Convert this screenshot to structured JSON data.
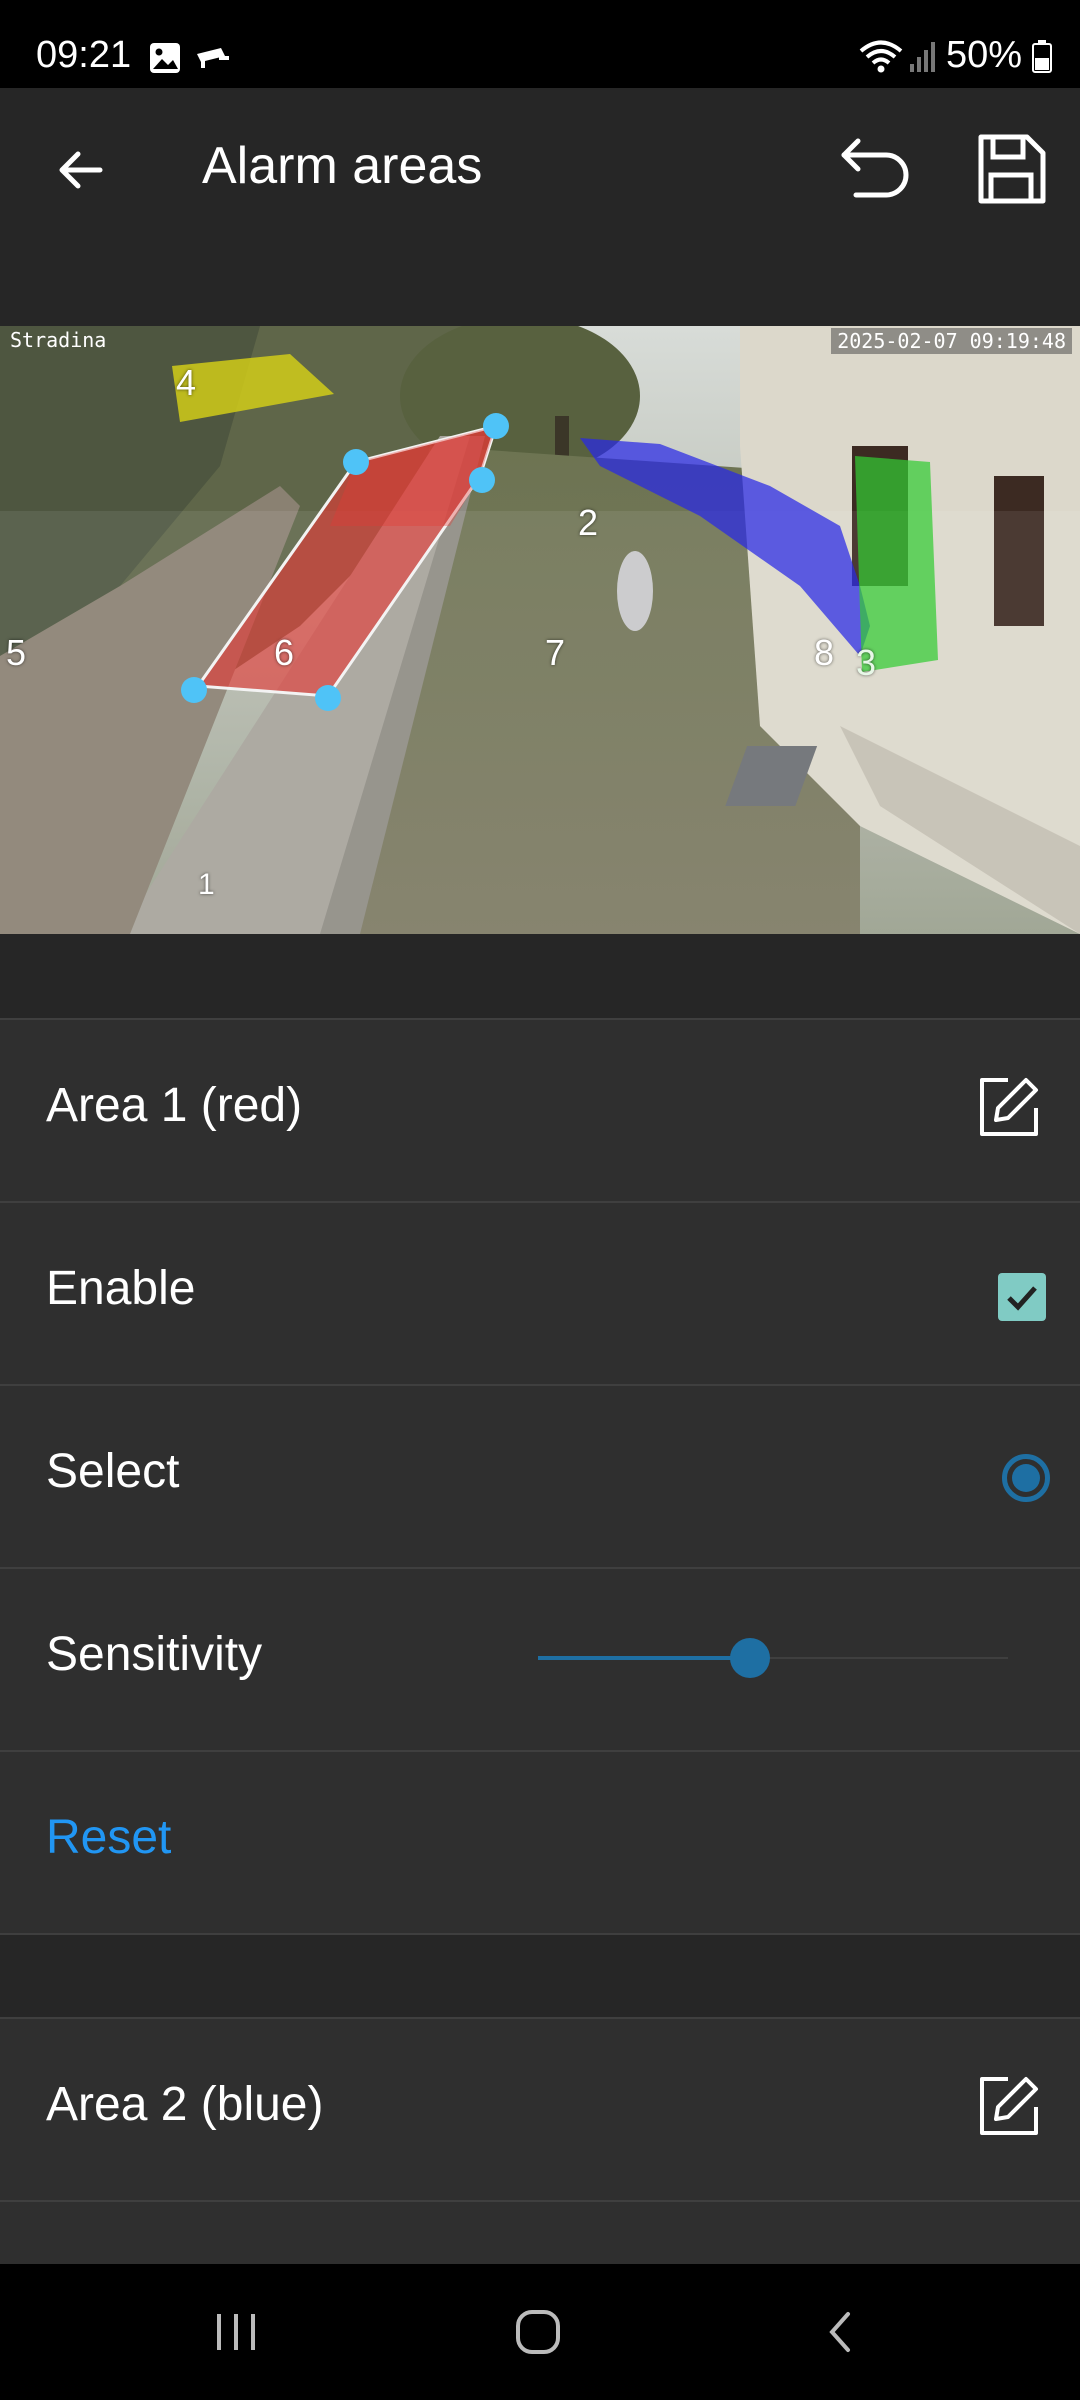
{
  "status_bar": {
    "time": "09:21",
    "battery": "50%",
    "icons": [
      "gallery-icon",
      "cctv-icon",
      "wifi-icon",
      "signal-icon",
      "battery-icon"
    ]
  },
  "app_bar": {
    "title": "Alarm areas",
    "icons": [
      "back-arrow-icon",
      "undo-icon",
      "save-icon"
    ]
  },
  "camera": {
    "name": "Stradina",
    "timestamp": "2025-02-07 09:19:48",
    "zone_labels": [
      "4",
      "2",
      "5",
      "6",
      "7",
      "8",
      "3",
      "1"
    ],
    "area_colors": {
      "red": "#e53935",
      "blue": "#2828e6",
      "green": "#33cc33",
      "yellow": "#d6d117"
    }
  },
  "area1": {
    "title": "Area 1 (red)",
    "enable_label": "Enable",
    "enabled": true,
    "select_label": "Select",
    "selected": true,
    "sensitivity_label": "Sensitivity",
    "sensitivity": 0.45,
    "reset_label": "Reset"
  },
  "area2": {
    "title": "Area 2 (blue)"
  },
  "colors": {
    "accent": "#1e6fa3",
    "link": "#2196f3",
    "check": "#80cbc4"
  }
}
